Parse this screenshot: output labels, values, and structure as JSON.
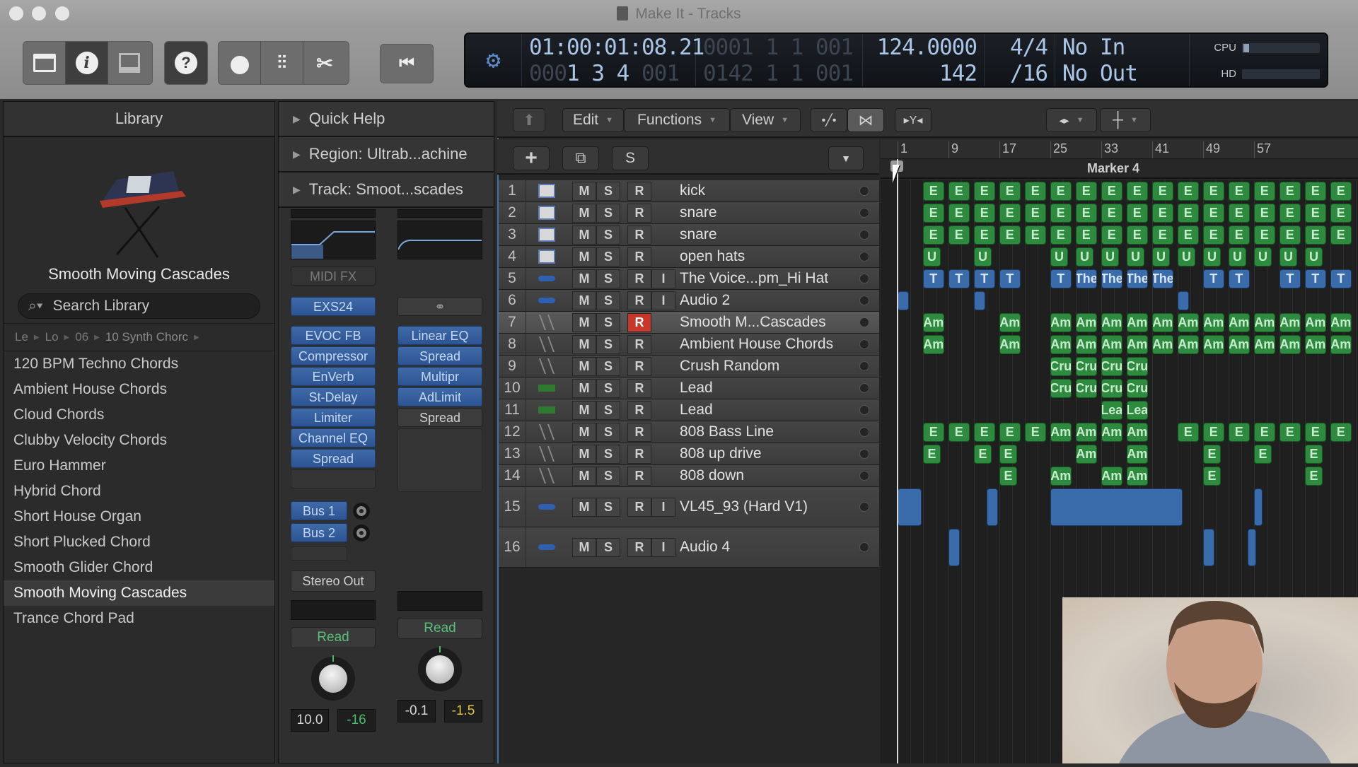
{
  "window": {
    "title": "Make It - Tracks"
  },
  "toolbar": {
    "buttons": [
      {
        "name": "library-button",
        "icon": "library-drawer-icon"
      },
      {
        "name": "inspector-button",
        "icon": "info-icon"
      },
      {
        "name": "editors-button",
        "icon": "editor-panel-icon"
      },
      {
        "name": "quick-help-button",
        "icon": "help-icon",
        "glyph": "?"
      },
      {
        "name": "smart-controls-button",
        "icon": "knob-icon"
      },
      {
        "name": "mixer-button",
        "icon": "mixer-faders-icon"
      },
      {
        "name": "editors-scissors-button",
        "icon": "scissors-icon"
      }
    ],
    "go_to_start_icon": "go-to-beginning-icon"
  },
  "lcd": {
    "smpte": "01:00:01:08.21",
    "bars_beats_dim": "0001  1  1  001",
    "position_top_prefix": "000",
    "position_bottom": "1  3  4",
    "position_bottom_suffix": "001",
    "end_position": "0142  1  1  001",
    "tempo": "124.0000",
    "bars": "142",
    "time_signature": "4/4",
    "division": "/16",
    "midi_in": "No In",
    "midi_out": "No Out",
    "cpu_label": "CPU",
    "hd_label": "HD",
    "cpu_load": 0.08,
    "hd_load": 0.0
  },
  "library": {
    "header": "Library",
    "patch_name": "Smooth Moving Cascades",
    "search_placeholder": "Search Library",
    "breadcrumbs": [
      "Le",
      "Lo",
      "06",
      "10 Synth Chorc"
    ],
    "items": [
      "120 BPM Techno Chords",
      "Ambient House Chords",
      "Cloud Chords",
      "Clubby Velocity Chords",
      "Euro Hammer",
      "Hybrid Chord",
      "Short House Organ",
      "Short Plucked Chord",
      "Smooth Glider Chord",
      "Smooth Moving Cascades",
      "Trance Chord Pad"
    ],
    "selected_index": 9
  },
  "inspector": {
    "quick_help": "Quick Help",
    "region": "Region: Ultrab...achine",
    "track": "Track:  Smoot...scades",
    "channel": {
      "midi_fx": "MIDI FX",
      "instrument": "EXS24",
      "plugins": [
        "EVOC FB",
        "Compressor",
        "EnVerb",
        "St-Delay",
        "Limiter",
        "Channel EQ",
        "Spread"
      ],
      "sends": [
        "Bus 1",
        "Bus 2"
      ],
      "output": "Stereo Out",
      "automation": "Read",
      "volume": "10.0",
      "peak": "-16"
    },
    "output_channel": {
      "plugins": [
        "Linear EQ",
        "Spread",
        "Multipr",
        "AdLimit"
      ],
      "plugin_grey": "Spread",
      "automation": "Read",
      "volume": "-0.1",
      "peak": "-1.5"
    }
  },
  "tracks_toolbar": {
    "menus": [
      "Edit",
      "Functions",
      "View"
    ],
    "add_track": "+",
    "solo_label": "S"
  },
  "ruler": {
    "bars": [
      "1",
      "9",
      "17",
      "25",
      "33",
      "41",
      "49",
      "57"
    ],
    "marker": "Marker 4"
  },
  "tracks": [
    {
      "num": "1",
      "name": "kick",
      "type": "drum",
      "input": false,
      "rec": false
    },
    {
      "num": "2",
      "name": "snare",
      "type": "drum",
      "input": false,
      "rec": false
    },
    {
      "num": "3",
      "name": "snare",
      "type": "drum",
      "input": false,
      "rec": false
    },
    {
      "num": "4",
      "name": "open hats",
      "type": "drum",
      "input": false,
      "rec": false
    },
    {
      "num": "5",
      "name": "The Voice...pm_Hi Hat",
      "type": "audio",
      "input": true,
      "rec": false
    },
    {
      "num": "6",
      "name": "Audio 2",
      "type": "audio",
      "input": true,
      "rec": false
    },
    {
      "num": "7",
      "name": "Smooth M...Cascades",
      "type": "synth",
      "input": false,
      "rec": true,
      "selected": true
    },
    {
      "num": "8",
      "name": "Ambient House Chords",
      "type": "synth",
      "input": false,
      "rec": false
    },
    {
      "num": "9",
      "name": "Crush Random",
      "type": "synth",
      "input": false,
      "rec": false
    },
    {
      "num": "10",
      "name": "Lead",
      "type": "lead",
      "input": false,
      "rec": false
    },
    {
      "num": "11",
      "name": "Lead",
      "type": "lead",
      "input": false,
      "rec": false
    },
    {
      "num": "12",
      "name": "808 Bass Line",
      "type": "synth",
      "input": false,
      "rec": false
    },
    {
      "num": "13",
      "name": "808 up drive",
      "type": "synth",
      "input": false,
      "rec": false
    },
    {
      "num": "14",
      "name": "808 down",
      "type": "synth",
      "input": false,
      "rec": false
    },
    {
      "num": "15",
      "name": "VL45_93 (Hard V1)",
      "type": "audio",
      "input": true,
      "rec": false,
      "tall": true
    },
    {
      "num": "16",
      "name": "Audio 4",
      "type": "audio",
      "input": true,
      "rec": false,
      "tall": true
    }
  ],
  "track_buttons": {
    "mute": "M",
    "solo": "S",
    "record": "R",
    "input": "I"
  },
  "region_labels": {
    "drum": "E",
    "hats": "U",
    "voice": "T",
    "voice_long": "The",
    "chord": "Am",
    "crush": "Cru",
    "lead": "Lea"
  },
  "colors": {
    "midi_region": "#2e8a3e",
    "audio_region": "#3a6cab",
    "record_armed": "#c8372c",
    "lcd_text": "#a9c6e8",
    "automation_read": "#58c07a",
    "peak_warn": "#e2c43c"
  },
  "webcam": {
    "description": "presenter webcam overlay"
  }
}
